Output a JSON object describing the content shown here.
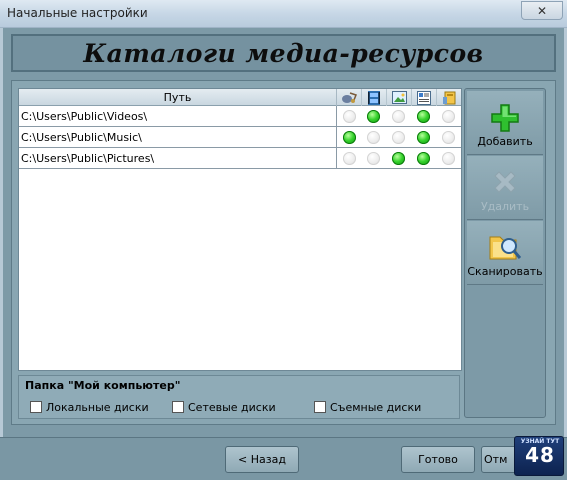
{
  "window": {
    "title": "Начальные настройки",
    "close_glyph": "✕"
  },
  "header": {
    "title": "Каталоги медиа-ресурсов"
  },
  "table": {
    "path_header": "Путь",
    "icon_headers": [
      "audio-icon",
      "video-icon",
      "image-icon",
      "document-icon",
      "other-icon"
    ],
    "rows": [
      {
        "path": "C:\\Users\\Public\\Videos\\",
        "flags": [
          false,
          true,
          false,
          true,
          false
        ]
      },
      {
        "path": "C:\\Users\\Public\\Music\\",
        "flags": [
          true,
          false,
          false,
          true,
          false
        ]
      },
      {
        "path": "C:\\Users\\Public\\Pictures\\",
        "flags": [
          false,
          false,
          true,
          true,
          false
        ]
      }
    ]
  },
  "side": {
    "add": "Добавить",
    "remove": "Удалить",
    "scan": "Сканировать"
  },
  "my_computer": {
    "title": "Папка \"Мой компьютер\"",
    "local": "Локальные диски",
    "network": "Сетевые диски",
    "removable": "Съемные диски"
  },
  "buttons": {
    "back": "< Назад",
    "done": "Готово",
    "cancel": "Отм"
  },
  "watermark": {
    "top": "УЗНАЙ ТУТ",
    "num": "48"
  }
}
